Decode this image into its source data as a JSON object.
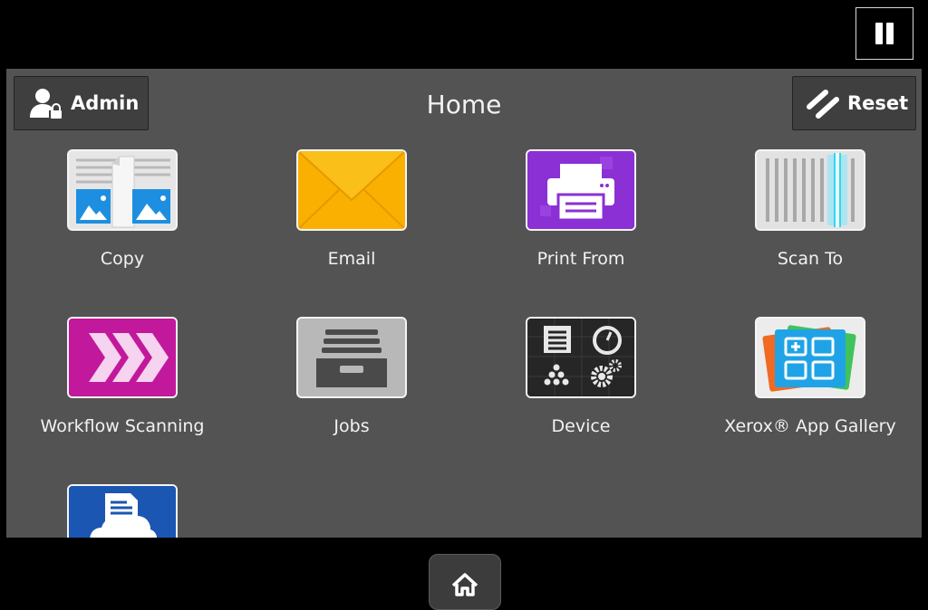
{
  "header": {
    "title": "Home",
    "admin_label": "Admin",
    "reset_label": "Reset"
  },
  "apps": [
    {
      "label": "Copy",
      "icon": "copy-icon"
    },
    {
      "label": "Email",
      "icon": "email-icon"
    },
    {
      "label": "Print From",
      "icon": "printer-icon"
    },
    {
      "label": "Scan To",
      "icon": "scanner-icon"
    },
    {
      "label": "Workflow Scanning",
      "icon": "workflow-chevrons-icon"
    },
    {
      "label": "Jobs",
      "icon": "jobs-tray-icon"
    },
    {
      "label": "Device",
      "icon": "device-gauges-icon"
    },
    {
      "label": "Xerox® App Gallery",
      "icon": "app-gallery-icon"
    },
    {
      "label": "",
      "icon": "cloud-document-icon"
    }
  ],
  "icons": {
    "pause": "pause-icon",
    "home": "home-icon",
    "admin": "user-icon",
    "reset": "reset-slashes-icon"
  },
  "colors": {
    "email": "#f7a800",
    "print": "#8c2fd6",
    "workflow": "#c0189a",
    "gallery_blue": "#1a9fe0",
    "cloud": "#1a57b4"
  }
}
